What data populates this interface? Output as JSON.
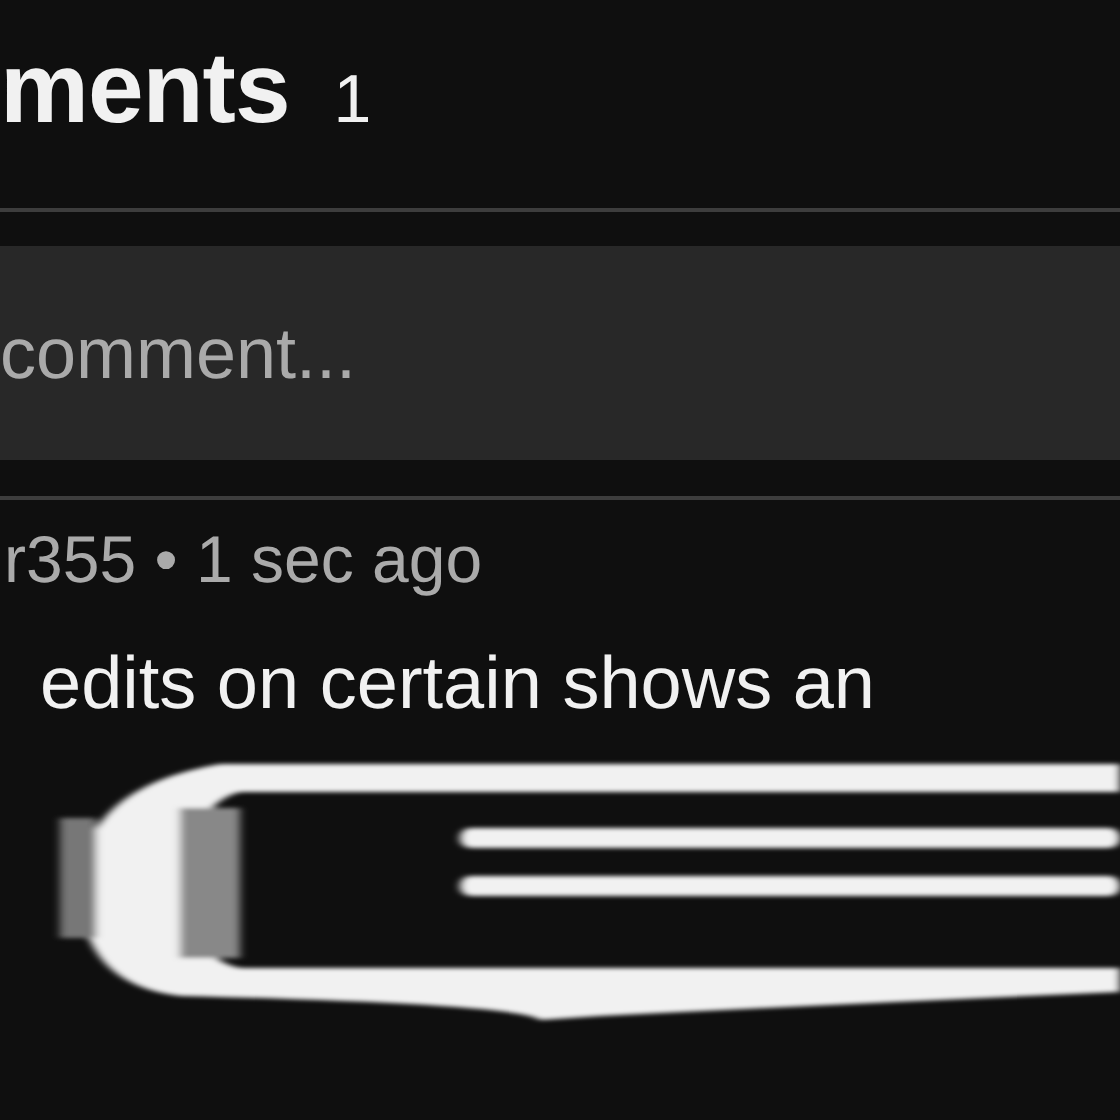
{
  "header": {
    "title": "ments",
    "count": "1"
  },
  "comment_field": {
    "placeholder": "comment..."
  },
  "comments": [
    {
      "meta": "r355 • 1 sec ago",
      "text": "edits on certain shows an"
    }
  ]
}
